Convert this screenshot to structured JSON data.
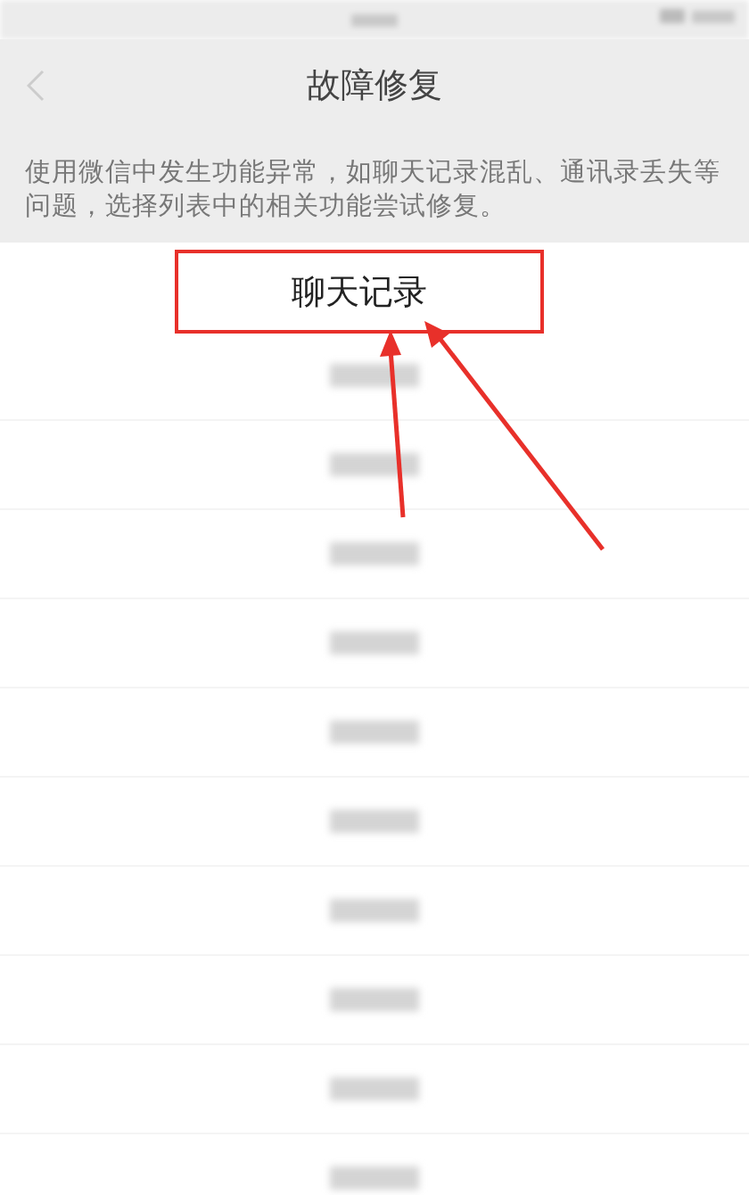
{
  "header": {
    "title": "故障修复"
  },
  "description": "使用微信中发生功能异常，如聊天记录混乱、通讯录丢失等问题，选择列表中的相关功能尝试修复。",
  "callout": {
    "label": "聊天记录"
  },
  "items": [
    {
      "kind": "blurred"
    },
    {
      "kind": "blurred"
    },
    {
      "kind": "blurred"
    },
    {
      "kind": "blurred"
    },
    {
      "kind": "blurred"
    },
    {
      "kind": "blurred"
    },
    {
      "kind": "blurred"
    },
    {
      "kind": "blurred"
    },
    {
      "kind": "blurred"
    },
    {
      "kind": "blurred"
    }
  ]
}
